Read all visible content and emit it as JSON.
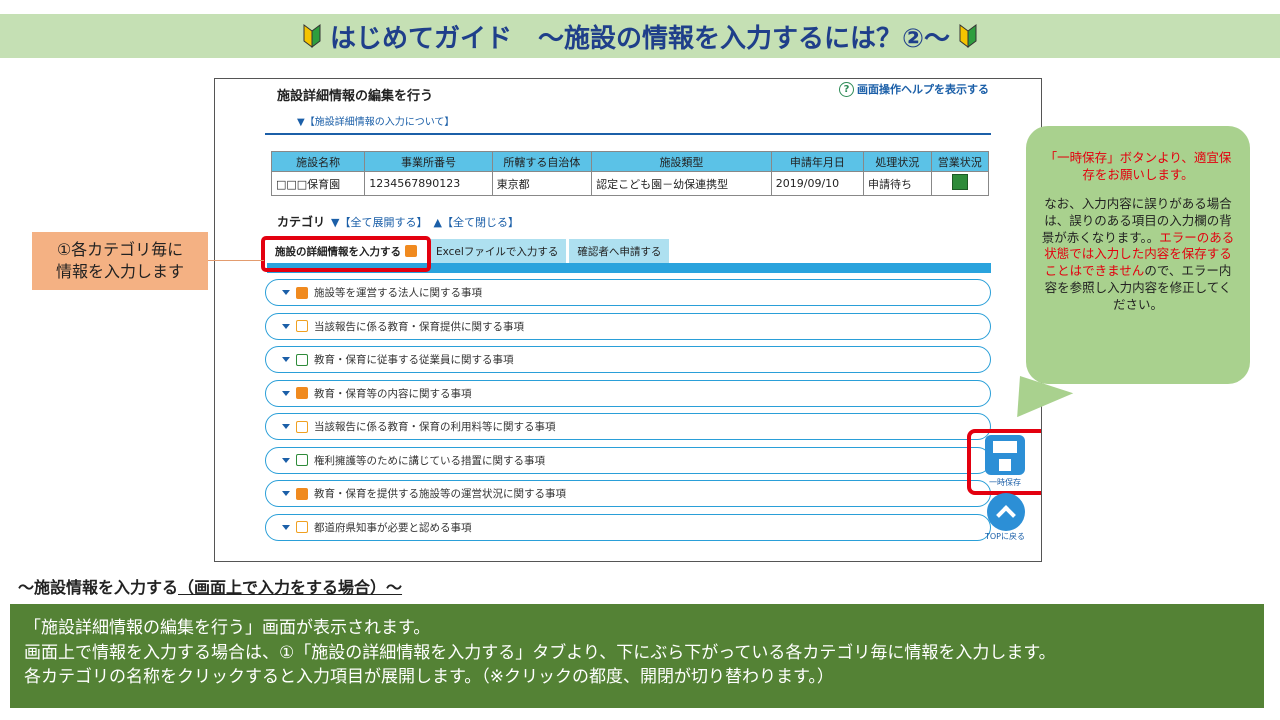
{
  "header": {
    "title": "はじめてガイド　～施設の情報を入力するには？②～"
  },
  "screen": {
    "page_title": "施設詳細情報の編集を行う",
    "help_link": "画面操作ヘルプを表示する",
    "about_link": "▼【施設詳細情報の入力について】",
    "table": {
      "headers": [
        "施設名称",
        "事業所番号",
        "所轄する自治体",
        "施設類型",
        "申請年月日",
        "処理状況",
        "営業状況"
      ],
      "row": [
        "□□□保育園",
        "1234567890123",
        "東京都",
        "認定こども園－幼保連携型",
        "2019/09/10",
        "申請待ち",
        ""
      ]
    },
    "category_label": "カテゴリ",
    "expand_all": "▼【全て展開する】",
    "collapse_all": "▲【全て閉じる】",
    "tabs": [
      {
        "label": "施設の詳細情報を入力する"
      },
      {
        "label": "Excelファイルで入力する"
      },
      {
        "label": "確認者へ申請する"
      }
    ],
    "categories": [
      {
        "label": "施設等を運営する法人に関する事項",
        "status": "error"
      },
      {
        "label": "当該報告に係る教育・保育提供に関する事項",
        "status": "warning"
      },
      {
        "label": "教育・保育に従事する従業員に関する事項",
        "status": "ok"
      },
      {
        "label": "教育・保育等の内容に関する事項",
        "status": "error"
      },
      {
        "label": "当該報告に係る教育・保育の利用料等に関する事項",
        "status": "warning"
      },
      {
        "label": "権利擁護等のために講じている措置に関する事項",
        "status": "ok"
      },
      {
        "label": "教育・保育を提供する施設等の運営状況に関する事項",
        "status": "error"
      },
      {
        "label": "都道府県知事が必要と認める事項",
        "status": "warning"
      }
    ],
    "save_label": "一時保存",
    "top_label": "TOPに戻る"
  },
  "callout_left": "①各カテゴリ毎に\n情報を入力します",
  "bubble": {
    "line1": "「一時保存」ボタンより、適宜保存をお願いします。",
    "p2_a": "なお、入力内容に誤りがある場合は、誤りのある項目の入力欄の背景が赤くなります。。",
    "p2_red": "エラーのある状態では入力した内容を保存することはできません",
    "p2_b": "ので、エラー内容を参照し入力内容を修正してください。"
  },
  "section": {
    "title_a": "～施設情報を入力する",
    "title_b": "（画面上で入力をする場合）～"
  },
  "info": {
    "line1": "「施設詳細情報の編集を行う」画面が表示されます。",
    "line2": "画面上で情報を入力する場合は、①「施設の詳細情報を入力する」タブより、下にぶら下がっている各カテゴリ毎に情報を入力します。",
    "line3": "各カテゴリの名称をクリックすると入力項目が展開します。（※クリックの都度、開閉が切り替わります。）"
  },
  "colors": {
    "title_bg": "#c5e0b4",
    "accent_blue": "#2aa3dd",
    "highlight_red": "#e3000f",
    "info_bg": "#548235",
    "bubble_bg": "#a9d18e",
    "callout_bg": "#f4b183"
  }
}
